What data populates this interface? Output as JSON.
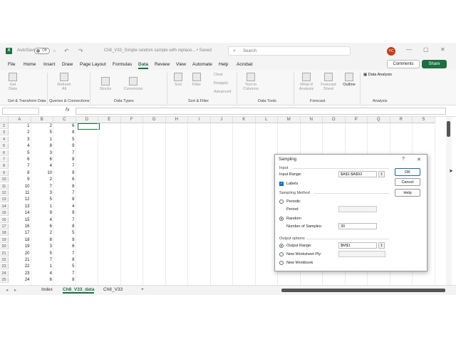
{
  "titlebar": {
    "autosave_label": "AutoSave",
    "toggle_state": "Off",
    "filename": "Ch8_V33_Simple random sample with replace...",
    "saved_status": "• Saved",
    "search_placeholder": "Search",
    "user_initials": "YC"
  },
  "menu": {
    "items": [
      "File",
      "Home",
      "Insert",
      "Draw",
      "Page Layout",
      "Formulas",
      "Data",
      "Review",
      "View",
      "Automate",
      "Help",
      "Acrobat"
    ],
    "active": "Data",
    "comments_label": "Comments",
    "share_label": "Share"
  },
  "ribbon": {
    "buttons": {
      "get_data": "Get Data",
      "refresh_all": "Refresh All",
      "stocks": "Stocks",
      "currencies": "Currencies",
      "sort": "Sort",
      "filter": "Filter",
      "clear": "Clear",
      "reapply": "Reapply",
      "advanced": "Advanced",
      "text_to_columns": "Text to Columns",
      "what_if": "What-If Analysis",
      "forecast_sheet": "Forecast Sheet",
      "outline": "Outline",
      "data_analysis": "Data Analysis"
    },
    "groups": {
      "get_transform": "Get & Transform Data",
      "queries": "Queries & Connections",
      "data_types": "Data Types",
      "sort_filter": "Sort & Filter",
      "data_tools": "Data Tools",
      "forecast": "Forecast",
      "analysis": "Analysis"
    }
  },
  "formula_bar": {
    "fx": "fx"
  },
  "grid": {
    "columns": [
      "A",
      "B",
      "C",
      "D",
      "E",
      "F",
      "G",
      "H",
      "I",
      "J",
      "K",
      "L",
      "M",
      "N",
      "O",
      "P",
      "Q",
      "R",
      "S"
    ],
    "rows": [
      {
        "n": "2",
        "a": "1",
        "b": "2",
        "c": "6"
      },
      {
        "n": "3",
        "a": "2",
        "b": "5",
        "c": "8"
      },
      {
        "n": "4",
        "a": "3",
        "b": "1",
        "c": "5"
      },
      {
        "n": "5",
        "a": "4",
        "b": "8",
        "c": "9"
      },
      {
        "n": "6",
        "a": "5",
        "b": "3",
        "c": "7"
      },
      {
        "n": "7",
        "a": "6",
        "b": "6",
        "c": "8"
      },
      {
        "n": "8",
        "a": "7",
        "b": "4",
        "c": "7"
      },
      {
        "n": "9",
        "a": "8",
        "b": "10",
        "c": "9"
      },
      {
        "n": "10",
        "a": "9",
        "b": "2",
        "c": "6"
      },
      {
        "n": "11",
        "a": "10",
        "b": "7",
        "c": "8"
      },
      {
        "n": "12",
        "a": "11",
        "b": "3",
        "c": "7"
      },
      {
        "n": "13",
        "a": "12",
        "b": "5",
        "c": "8"
      },
      {
        "n": "14",
        "a": "13",
        "b": "1",
        "c": "4"
      },
      {
        "n": "15",
        "a": "14",
        "b": "9",
        "c": "9"
      },
      {
        "n": "16",
        "a": "15",
        "b": "4",
        "c": "7"
      },
      {
        "n": "17",
        "a": "16",
        "b": "6",
        "c": "8"
      },
      {
        "n": "18",
        "a": "17",
        "b": "2",
        "c": "5"
      },
      {
        "n": "19",
        "a": "18",
        "b": "8",
        "c": "9"
      },
      {
        "n": "20",
        "a": "19",
        "b": "3",
        "c": "6"
      },
      {
        "n": "21",
        "a": "20",
        "b": "5",
        "c": "7"
      },
      {
        "n": "22",
        "a": "21",
        "b": "7",
        "c": "8"
      },
      {
        "n": "23",
        "a": "22",
        "b": "1",
        "c": "5"
      },
      {
        "n": "24",
        "a": "23",
        "b": "4",
        "c": "7"
      },
      {
        "n": "25",
        "a": "24",
        "b": "6",
        "c": "8"
      }
    ]
  },
  "sheets": {
    "tabs": [
      "Index",
      "Ch8_V33_data",
      "Ch8_V33"
    ],
    "active": "Ch8_V33_data",
    "add": "+"
  },
  "dialog": {
    "title": "Sampling",
    "help_glyph": "?",
    "close_glyph": "✕",
    "input_section": "Input",
    "input_range_label": "Input Range:",
    "input_range_value": "$A$1:$A$92",
    "labels_label": "Labels",
    "sampling_method_section": "Sampling Method",
    "periodic_label": "Periodic",
    "period_label": "Period:",
    "random_label": "Random",
    "num_samples_label": "Number of Samples:",
    "num_samples_value": "30",
    "output_section": "Output options",
    "output_range_label": "Output Range:",
    "output_range_value": "$M$1",
    "new_ws_label": "New Worksheet Ply:",
    "new_wb_label": "New Workbook",
    "ok": "OK",
    "cancel": "Cancel",
    "help": "Help"
  }
}
